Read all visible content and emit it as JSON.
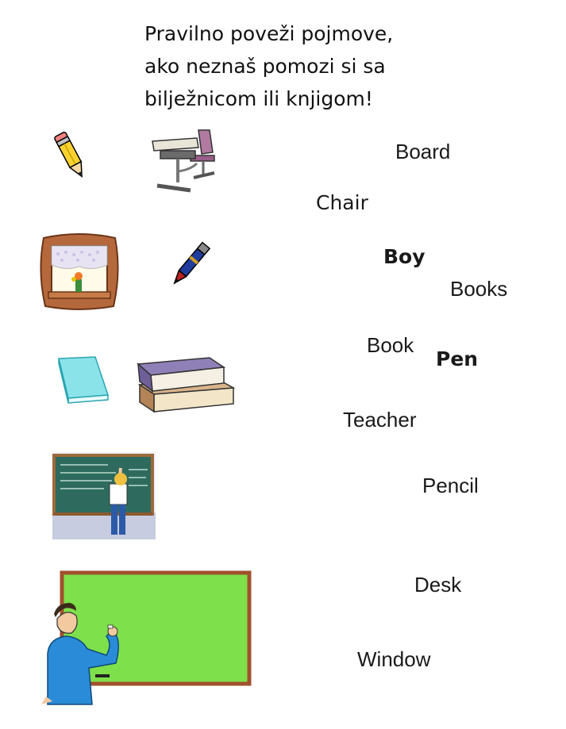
{
  "instructions": [
    "Pravilno poveži pojmove,",
    "ako neznaš pomozi si sa",
    "bilježnicom ili knjigom!"
  ],
  "words": [
    "Board",
    "Chair",
    "Boy",
    "Books",
    "Book",
    "Pen",
    "Teacher",
    "Pencil",
    "Desk",
    "Window"
  ],
  "pictures": [
    "pencil-icon",
    "desk-chair-icon",
    "window-icon",
    "pen-icon",
    "book-icon",
    "books-icon",
    "teacher-at-board-icon",
    "boy-at-board-icon"
  ],
  "colors": {
    "board_green": "#7ee04a",
    "board_frame": "#a0522d",
    "chalkboard": "#2e6b5e",
    "book_cyan": "#8be3ea",
    "shirt_blue": "#2a8cd8"
  }
}
